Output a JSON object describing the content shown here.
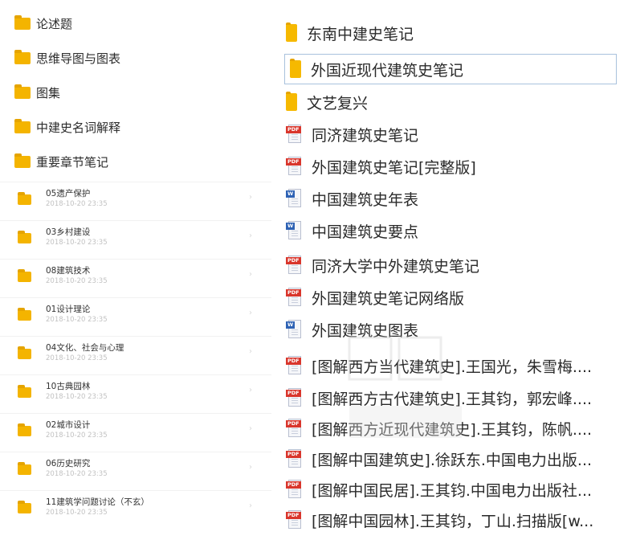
{
  "left_folders": [
    {
      "name": "论述题",
      "icon": "folder-icon"
    },
    {
      "name": "思维导图与图表",
      "icon": "folder-icon"
    },
    {
      "name": "图集",
      "icon": "folder-icon"
    },
    {
      "name": "中建史名词解释",
      "icon": "folder-icon"
    },
    {
      "name": "重要章节笔记",
      "icon": "folder-icon"
    }
  ],
  "recent_items": [
    {
      "name": "05遗产保护",
      "time": "2018-10-20 23:35"
    },
    {
      "name": "03乡村建设",
      "time": "2018-10-20 23:35"
    },
    {
      "name": "08建筑技术",
      "time": "2018-10-20 23:35"
    },
    {
      "name": "01设计理论",
      "time": "2018-10-20 23:35"
    },
    {
      "name": "04文化、社会与心理",
      "time": "2018-10-20 23:35"
    },
    {
      "name": "10古典园林",
      "time": "2018-10-20 23:35"
    },
    {
      "name": "02城市设计",
      "time": "2018-10-20 23:35"
    },
    {
      "name": "06历史研究",
      "time": "2018-10-20 23:35"
    },
    {
      "name": "11建筑学问题讨论（不玄）",
      "time": "2018-10-20 23:35"
    }
  ],
  "right_items": [
    {
      "name": "东南中建史笔记",
      "type": "folder"
    },
    {
      "name": "外国近现代建筑史笔记",
      "type": "folder",
      "selected": true
    },
    {
      "name": "文艺复兴",
      "type": "folder"
    },
    {
      "name": "同济建筑史笔记",
      "type": "pdf"
    },
    {
      "name": "外国建筑史笔记[完整版]",
      "type": "pdf"
    },
    {
      "name": "中国建筑史年表",
      "type": "doc"
    },
    {
      "name": "中国建筑史要点",
      "type": "doc"
    },
    {
      "name": "同济大学中外建筑史笔记",
      "type": "pdf"
    },
    {
      "name": "外国建筑史笔记网络版",
      "type": "pdf"
    },
    {
      "name": "外国建筑史图表",
      "type": "doc"
    },
    {
      "name": "[图解西方当代建筑史].王国光，朱雪梅....",
      "type": "pdf"
    },
    {
      "name": "[图解西方古代建筑史].王其钧，郭宏峰....",
      "type": "pdf"
    },
    {
      "name": "[图解西方近现代建筑史].王其钧，陈帆....",
      "type": "pdf"
    },
    {
      "name": "[图解中国建筑史].徐跃东.中国电力出版...",
      "type": "pdf"
    },
    {
      "name": "[图解中国民居].王其钧.中国电力出版社...",
      "type": "pdf"
    },
    {
      "name": "[图解中国园林].王其钧，丁山.扫描版[w...",
      "type": "pdf"
    }
  ],
  "file_tags": {
    "pdf": "PDF",
    "doc": "W"
  },
  "colors": {
    "folder": "#f4b400",
    "pdf": "#d9362c",
    "doc": "#2e62b4",
    "selection_border": "#a9c2dd"
  }
}
